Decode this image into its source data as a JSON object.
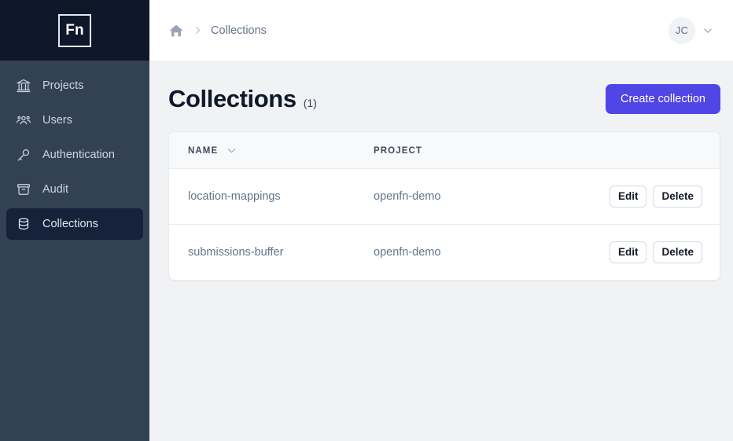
{
  "sidebar": {
    "logo_text": "Fn",
    "items": [
      {
        "label": "Projects",
        "icon": "bank-icon",
        "active": false
      },
      {
        "label": "Users",
        "icon": "users-icon",
        "active": false
      },
      {
        "label": "Authentication",
        "icon": "key-icon",
        "active": false
      },
      {
        "label": "Audit",
        "icon": "archive-box-icon",
        "active": false
      },
      {
        "label": "Collections",
        "icon": "database-icon",
        "active": true
      }
    ]
  },
  "topbar": {
    "breadcrumb": {
      "home_icon": "home-icon",
      "separator": "›",
      "current": "Collections"
    },
    "user": {
      "initials": "JC",
      "caret_icon": "chevron-down-icon"
    }
  },
  "page": {
    "title": "Collections",
    "count": "(1)",
    "create_button": "Create collection"
  },
  "table": {
    "columns": [
      "NAME",
      "PROJECT",
      ""
    ],
    "sort_icon": "chevron-down-icon",
    "rows": [
      {
        "name": "location-mappings",
        "project": "openfn-demo",
        "edit": "Edit",
        "delete": "Delete"
      },
      {
        "name": "submissions-buffer",
        "project": "openfn-demo",
        "edit": "Edit",
        "delete": "Delete"
      }
    ]
  },
  "colors": {
    "sidebar_bg": "#334155",
    "sidebar_logo_bg": "#0f172a",
    "sidebar_active_bg": "#16213a",
    "accent": "#4f46e5",
    "content_bg": "#f1f2f4"
  }
}
